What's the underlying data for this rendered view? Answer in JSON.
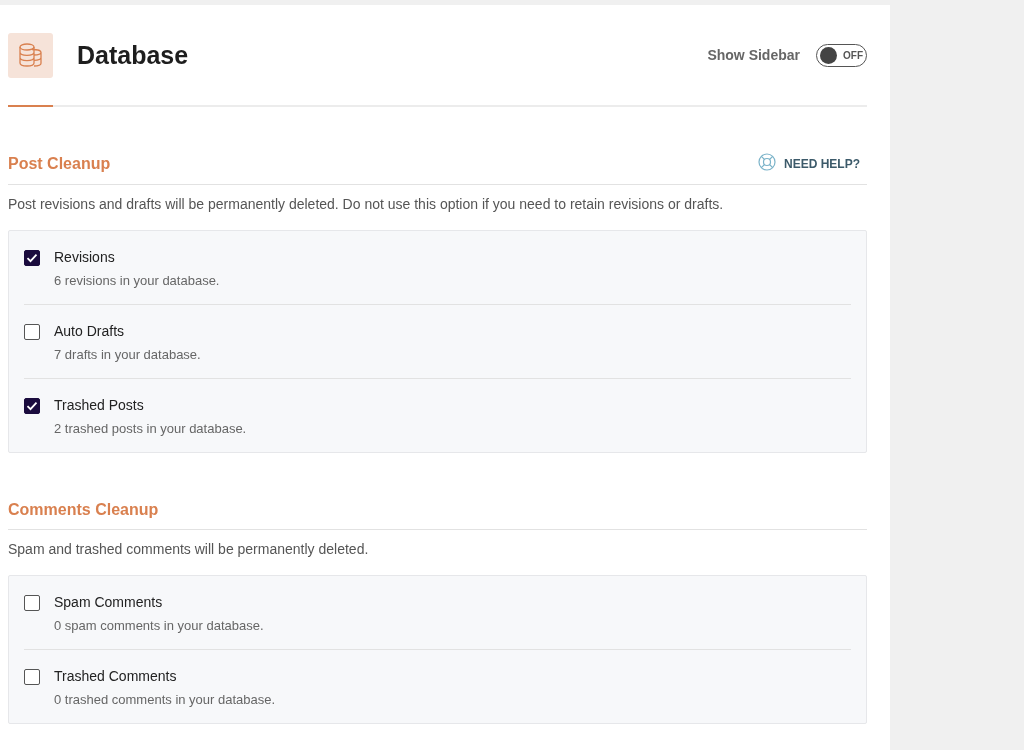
{
  "header": {
    "title": "Database",
    "sidebar_toggle": {
      "label": "Show Sidebar",
      "on": false,
      "state_text": "OFF"
    }
  },
  "sections": [
    {
      "title": "Post Cleanup",
      "help": "NEED HELP?",
      "description": "Post revisions and drafts will be permanently deleted. Do not use this option if you need to retain revisions or drafts.",
      "items": [
        {
          "label": "Revisions",
          "detail": "6 revisions in your database.",
          "checked": true
        },
        {
          "label": "Auto Drafts",
          "detail": "7 drafts in your database.",
          "checked": false
        },
        {
          "label": "Trashed Posts",
          "detail": "2 trashed posts in your database.",
          "checked": true
        }
      ]
    },
    {
      "title": "Comments Cleanup",
      "description": "Spam and trashed comments will be permanently deleted.",
      "items": [
        {
          "label": "Spam Comments",
          "detail": "0 spam comments in your database.",
          "checked": false
        },
        {
          "label": "Trashed Comments",
          "detail": "0 trashed comments in your database.",
          "checked": false
        }
      ]
    }
  ]
}
